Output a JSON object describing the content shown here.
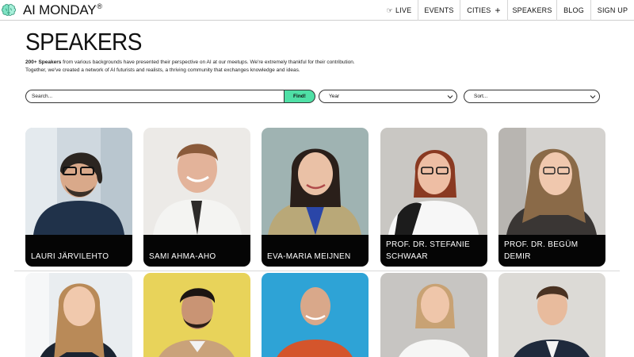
{
  "header": {
    "brand": "AI MONDAY",
    "brand_mark": "®",
    "logo_icon": "brain-icon",
    "nav": [
      {
        "label": "LIVE",
        "icon": "pointing-hand-icon"
      },
      {
        "label": "EVENTS"
      },
      {
        "label": "CITIES",
        "icon": "plus-icon"
      },
      {
        "label": "SPEAKERS"
      },
      {
        "label": "BLOG"
      },
      {
        "label": "SIGN UP"
      }
    ]
  },
  "page": {
    "title": "SPEAKERS",
    "intro_bold": "200+ Speakers",
    "intro_line1": " from various backgrounds have presented their perspective on AI at our meetups. We're extremely thankful for their contribution.",
    "intro_line2": "Together, we've created a network of AI futurists and realists, a thriving community that exchanges knowledge and ideas."
  },
  "filters": {
    "search_placeholder": "Search...",
    "find_label": "Find!",
    "year_label": "Year",
    "sort_label": "Sort..."
  },
  "speakers": [
    {
      "name": "LAURI JÄRVILEHTO"
    },
    {
      "name": "SAMI AHMA-AHO"
    },
    {
      "name": "EVA-MARIA MEIJNEN"
    },
    {
      "name_line1": "PROF. DR. STEFANIE",
      "name_line2": "SCHWAAR"
    },
    {
      "name_line1": "PROF. DR. BEGÜM",
      "name_line2": "DEMIR"
    }
  ],
  "colors": {
    "accent": "#4fe0a6",
    "text": "#111111",
    "label_band": "#050505"
  }
}
